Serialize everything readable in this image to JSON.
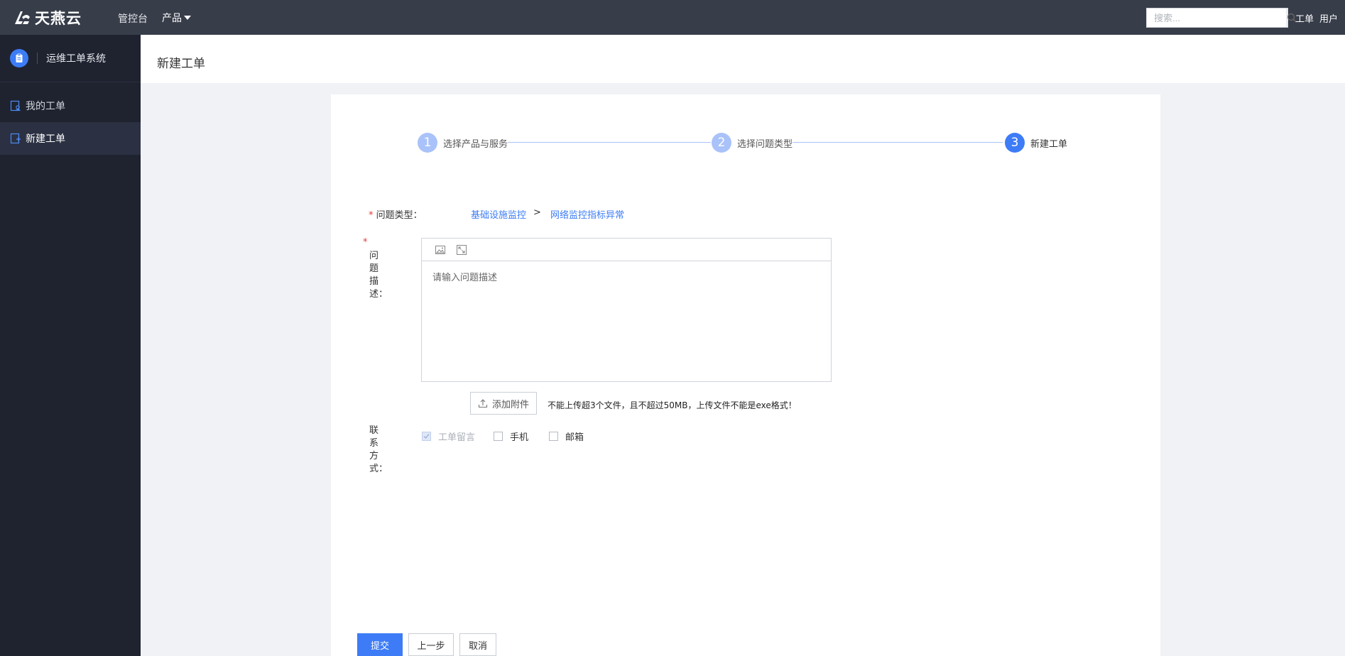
{
  "topbar": {
    "logo_text": "天燕云",
    "nav_console": "管控台",
    "nav_product": "产品",
    "search_placeholder": "搜索...",
    "link_ticket": "工单",
    "link_user": "用户"
  },
  "sidebar": {
    "system_name": "运维工单系统",
    "items": [
      {
        "label": "我的工单",
        "icon": "user-ticket-icon",
        "active": false
      },
      {
        "label": "新建工单",
        "icon": "new-ticket-icon",
        "active": true
      }
    ]
  },
  "page": {
    "title": "新建工单"
  },
  "steps": [
    {
      "number": "1",
      "label": "选择产品与服务",
      "state": "done"
    },
    {
      "number": "2",
      "label": "选择问题类型",
      "state": "done"
    },
    {
      "number": "3",
      "label": "新建工单",
      "state": "current"
    }
  ],
  "form": {
    "required_mark": "*",
    "issue_type_label": "问题类型：",
    "issue_category": "基础设施监控",
    "issue_separator": ">",
    "issue_subcategory": "网络监控指标异常",
    "description_label": [
      "问",
      "题",
      "描",
      "述："
    ],
    "description_placeholder": "请输入问题描述",
    "attach_button": "添加附件",
    "upload_note": "不能上传超3个文件，且不超过50MB，上传文件不能是exe格式！",
    "contact_label": [
      "联",
      "系",
      "方",
      "式："
    ],
    "contact_options": [
      {
        "label": "工单留言",
        "checked": true,
        "disabled": true
      },
      {
        "label": "手机",
        "checked": false,
        "disabled": false
      },
      {
        "label": "邮箱",
        "checked": false,
        "disabled": false
      }
    ]
  },
  "actions": {
    "submit": "提交",
    "previous": "上一步",
    "cancel": "取消"
  },
  "colors": {
    "primary": "#3d7cf6",
    "step_done": "#a9c2f9",
    "topbar_bg": "#373d49",
    "sidebar_bg": "#1f2330",
    "required": "#e63b3b"
  }
}
